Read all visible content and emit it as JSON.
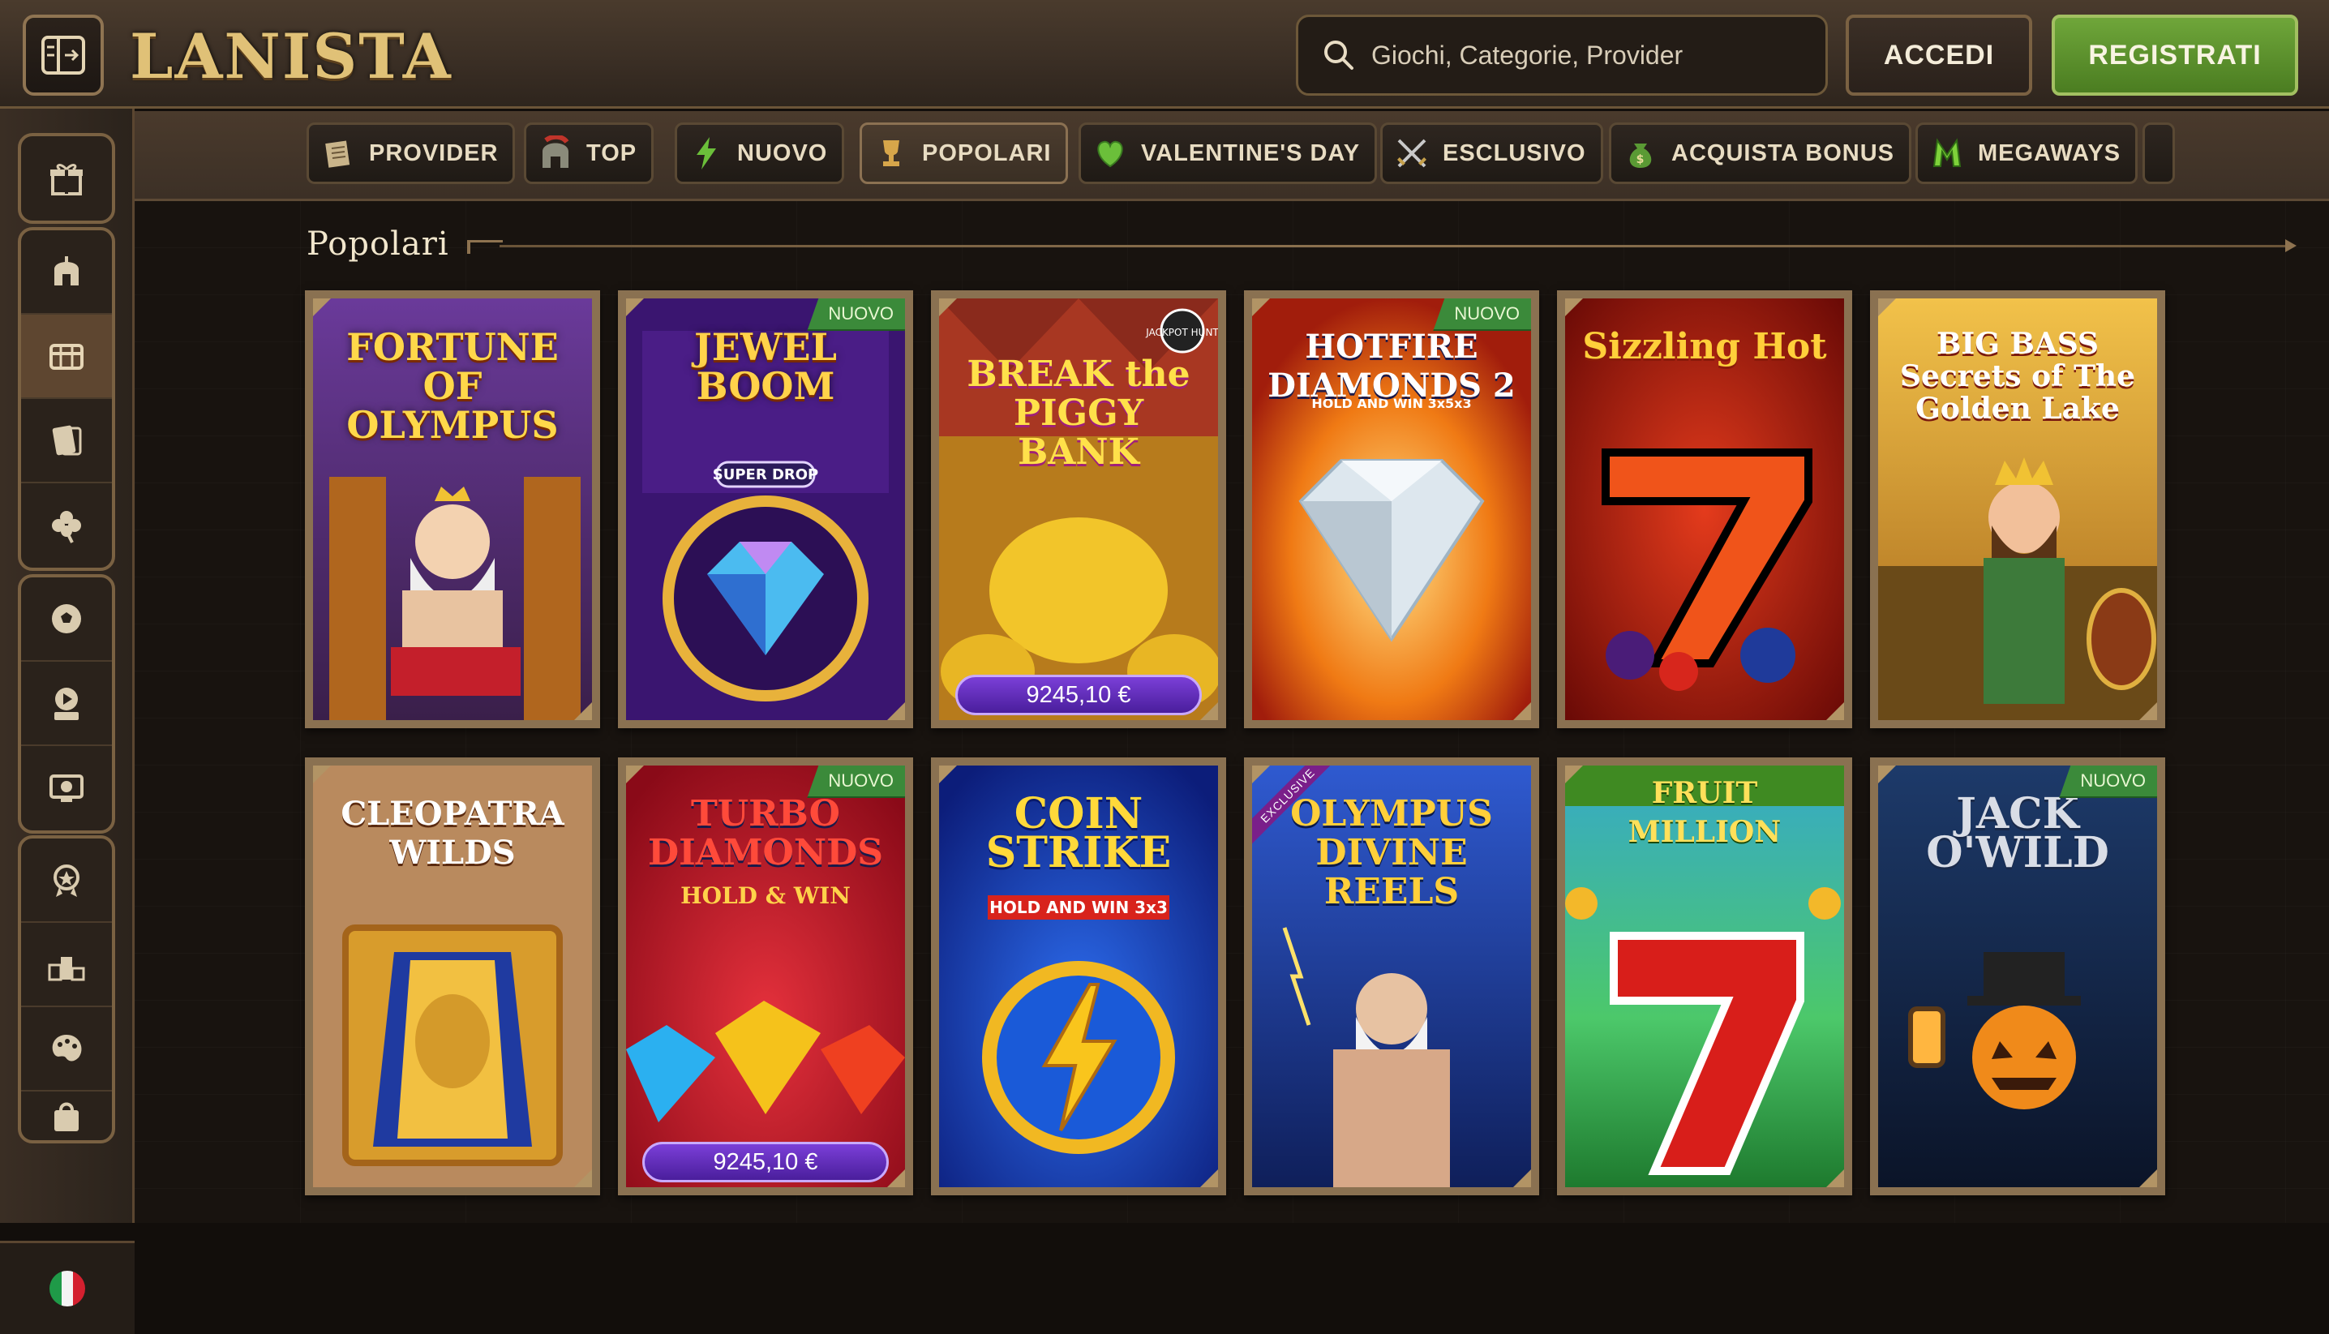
{
  "header": {
    "logo_text": "LANISTA",
    "search_placeholder": "Giochi, Categorie, Provider",
    "login_label": "ACCEDI",
    "register_label": "REGISTRATI"
  },
  "categories": [
    {
      "label": "PROVIDER",
      "icon": "scroll-icon"
    },
    {
      "label": "TOP",
      "icon": "helmet-icon"
    },
    {
      "label": "NUOVO",
      "icon": "lightning-icon"
    },
    {
      "label": "POPOLARI",
      "icon": "trophy-icon"
    },
    {
      "label": "VALENTINE'S DAY",
      "icon": "heart-icon"
    },
    {
      "label": "ESCLUSIVO",
      "icon": "crossed-swords-icon"
    },
    {
      "label": "ACQUISTA BONUS",
      "icon": "money-bag-icon"
    },
    {
      "label": "MEGAWAYS",
      "icon": "megaways-icon"
    }
  ],
  "sidebar": {
    "items": [
      "gift-icon",
      "helmet-icon",
      "slot-machine-icon",
      "cards-icon",
      "clover-icon",
      "soccer-ball-icon",
      "live-icon",
      "virtual-sports-icon",
      "badge-icon",
      "podium-icon",
      "palette-icon",
      "bag-icon"
    ],
    "language_flag": "italy-flag-icon"
  },
  "section": {
    "title": "Popolari"
  },
  "badges": {
    "new": "NUOVO",
    "exclusive": "EXCLUSIVE"
  },
  "games": [
    {
      "title": "FORTUNE OF OLYMPUS",
      "badge": "",
      "jackpot": ""
    },
    {
      "title": "JEWEL BOOM",
      "subtitle": "SUPER DROP",
      "badge": "NUOVO",
      "jackpot": ""
    },
    {
      "title": "BREAK the PIGGY BANK",
      "subtitle": "JACKPOT HUNT",
      "badge": "",
      "jackpot": "9245,10 €"
    },
    {
      "title": "HOTFIRE DIAMONDS 2",
      "subtitle": "HOLD AND WIN 3x5x3",
      "badge": "NUOVO",
      "jackpot": ""
    },
    {
      "title": "Sizzling Hot",
      "badge": "",
      "jackpot": ""
    },
    {
      "title": "BIG BASS Secrets of The Golden Lake",
      "badge": "",
      "jackpot": ""
    },
    {
      "title": "CLEOPATRA WILDS",
      "badge": "",
      "jackpot": ""
    },
    {
      "title": "TURBO DIAMONDS",
      "subtitle": "HOLD & WIN",
      "badge": "NUOVO",
      "jackpot": "9245,10 €"
    },
    {
      "title": "COIN STRIKE",
      "subtitle": "HOLD AND WIN 3x3",
      "badge": "",
      "jackpot": ""
    },
    {
      "title": "OLYMPUS DIVINE REELS",
      "badge": "EXCLUSIVE",
      "jackpot": ""
    },
    {
      "title": "FRUIT MILLION",
      "badge": "",
      "jackpot": ""
    },
    {
      "title": "JACK O'WILD",
      "badge": "NUOVO",
      "jackpot": ""
    }
  ],
  "colors": {
    "accent_gold": "#e0c177",
    "register_green": "#5e9230",
    "frame": "#8a7151",
    "new_badge": "#3b8a3a",
    "jackpot_purple": "#6a33c0"
  }
}
